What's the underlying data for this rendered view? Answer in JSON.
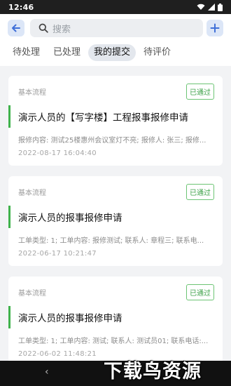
{
  "status_bar": {
    "time": "12:46"
  },
  "search": {
    "placeholder": "搜索"
  },
  "tabs": [
    {
      "label": "待处理",
      "active": false
    },
    {
      "label": "已处理",
      "active": false
    },
    {
      "label": "我的提交",
      "active": true
    },
    {
      "label": "待评价",
      "active": false
    }
  ],
  "cards": [
    {
      "type": "基本流程",
      "status": "已通过",
      "title": "演示人员的【写字楼】工程报事报修申请",
      "desc": "报修内容: 测试25楼惠州会议室灯不亮; 报修人: 张三; 报修...",
      "time": "2022-08-17 16:04:40"
    },
    {
      "type": "基本流程",
      "status": "已通过",
      "title": "演示人员的报事报修申请",
      "desc": "工单类型: 1; 工单内容: 报修测试; 联系人: 章程三; 联系电...",
      "time": "2022-06-17 10:21:47"
    },
    {
      "type": "基本流程",
      "status": "已通过",
      "title": "演示人员的报事报修申请",
      "desc": "工单类型: 1; 工单内容: 测试; 联系人: 测试员01; 联系电话:...",
      "time": "2022-06-02 11:48:21"
    }
  ],
  "watermark": {
    "text": "下载鸟资源"
  },
  "colors": {
    "accent": "#3f6fd8",
    "status_green": "#3fa24a",
    "header_bg": "#ffffff"
  }
}
